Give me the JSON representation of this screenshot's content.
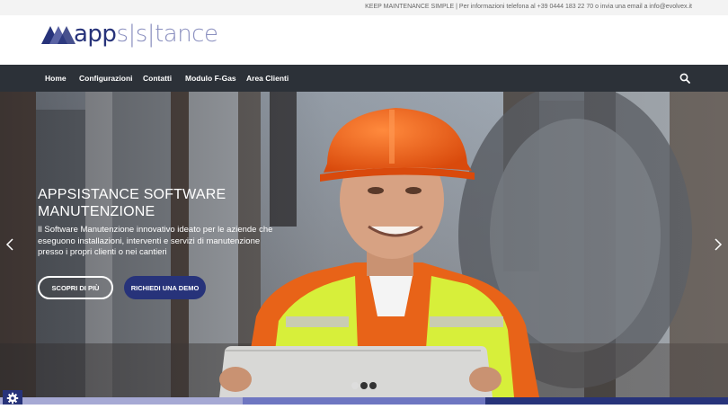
{
  "topbar": {
    "text": "KEEP MAINTENANCE SIMPLE | Per informazioni telefona al +39 0444 183 22 70 o invia una email a info@evolvex.it"
  },
  "logo": {
    "part1": "app",
    "part2": "s|s|tance"
  },
  "nav": {
    "items": [
      {
        "label": "Home"
      },
      {
        "label": "Configurazioni"
      },
      {
        "label": "Contatti"
      },
      {
        "label": "Modulo F-Gas"
      },
      {
        "label": "Area Clienti"
      }
    ],
    "search_icon": "search-icon"
  },
  "hero": {
    "title": "APPSISTANCE SOFTWARE MANUTENZIONE",
    "subtitle": "Il Software Manutenzione innovativo ideato per le aziende che eseguono installazioni, interventi e servizi di manutenzione presso i propri clienti o nei cantieri",
    "button_primary": "SCOPRI DI PIÙ",
    "button_secondary": "RICHIEDI UNA DEMO",
    "slides": 3,
    "active_slide": 1
  },
  "colors": {
    "brand_dark": "#27337a",
    "brand_light": "#8a8fbf",
    "nav_bg": "#2c3138",
    "vest": "#d7ef3a",
    "helmet": "#f05a12"
  },
  "icons": [
    "gear-icon",
    "chevron-left-icon",
    "chevron-right-icon",
    "search-icon"
  ]
}
